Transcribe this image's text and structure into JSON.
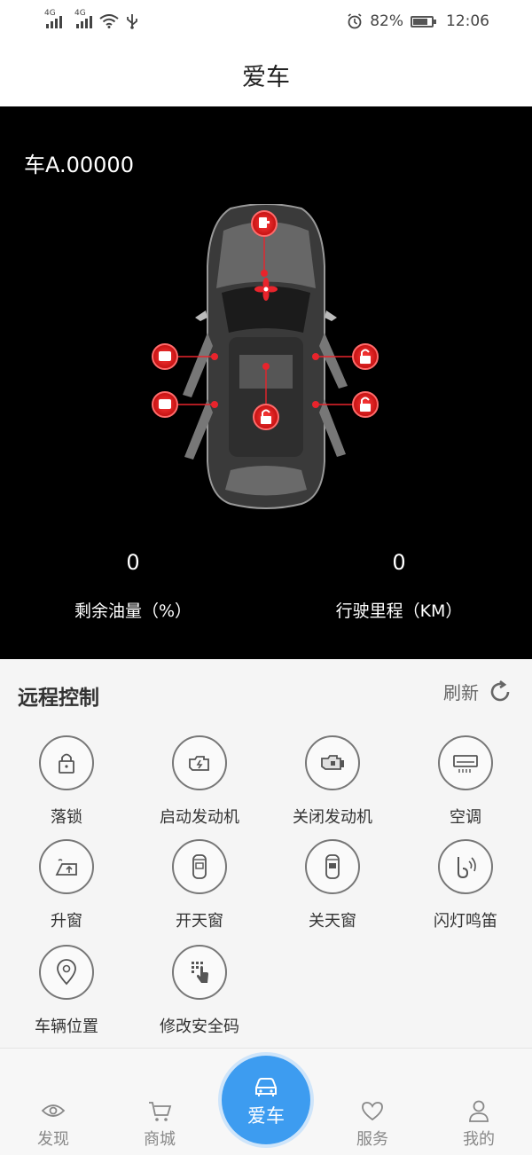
{
  "status_bar": {
    "network1": "4G",
    "network2": "4G",
    "battery_percent": "82%",
    "battery_level": 0.82,
    "time": "12:06"
  },
  "header": {
    "title": "爱车"
  },
  "car": {
    "plate": "车A.00000",
    "fuel_value": "0",
    "fuel_label": "剩余油量（%）",
    "mileage_value": "0",
    "mileage_label": "行驶里程（KM）"
  },
  "remote": {
    "title": "远程控制",
    "refresh_label": "刷新",
    "controls": [
      {
        "label": "落锁",
        "icon": "lock-icon"
      },
      {
        "label": "启动发动机",
        "icon": "engine-start-icon"
      },
      {
        "label": "关闭发动机",
        "icon": "engine-stop-icon"
      },
      {
        "label": "空调",
        "icon": "air-conditioner-icon"
      },
      {
        "label": "升窗",
        "icon": "window-up-icon"
      },
      {
        "label": "开天窗",
        "icon": "sunroof-open-icon"
      },
      {
        "label": "关天窗",
        "icon": "sunroof-close-icon"
      },
      {
        "label": "闪灯鸣笛",
        "icon": "horn-icon"
      },
      {
        "label": "车辆位置",
        "icon": "location-pin-icon"
      },
      {
        "label": "修改安全码",
        "icon": "keypad-icon"
      }
    ]
  },
  "tabbar": {
    "items": [
      {
        "label": "发现",
        "icon": "eye-icon"
      },
      {
        "label": "商城",
        "icon": "cart-icon"
      },
      {
        "label": "爱车",
        "icon": "car-icon"
      },
      {
        "label": "服务",
        "icon": "heart-icon"
      },
      {
        "label": "我的",
        "icon": "person-icon"
      }
    ]
  },
  "colors": {
    "accent": "#3d9cf0",
    "alert": "#e8242c",
    "panel": "#000000"
  }
}
